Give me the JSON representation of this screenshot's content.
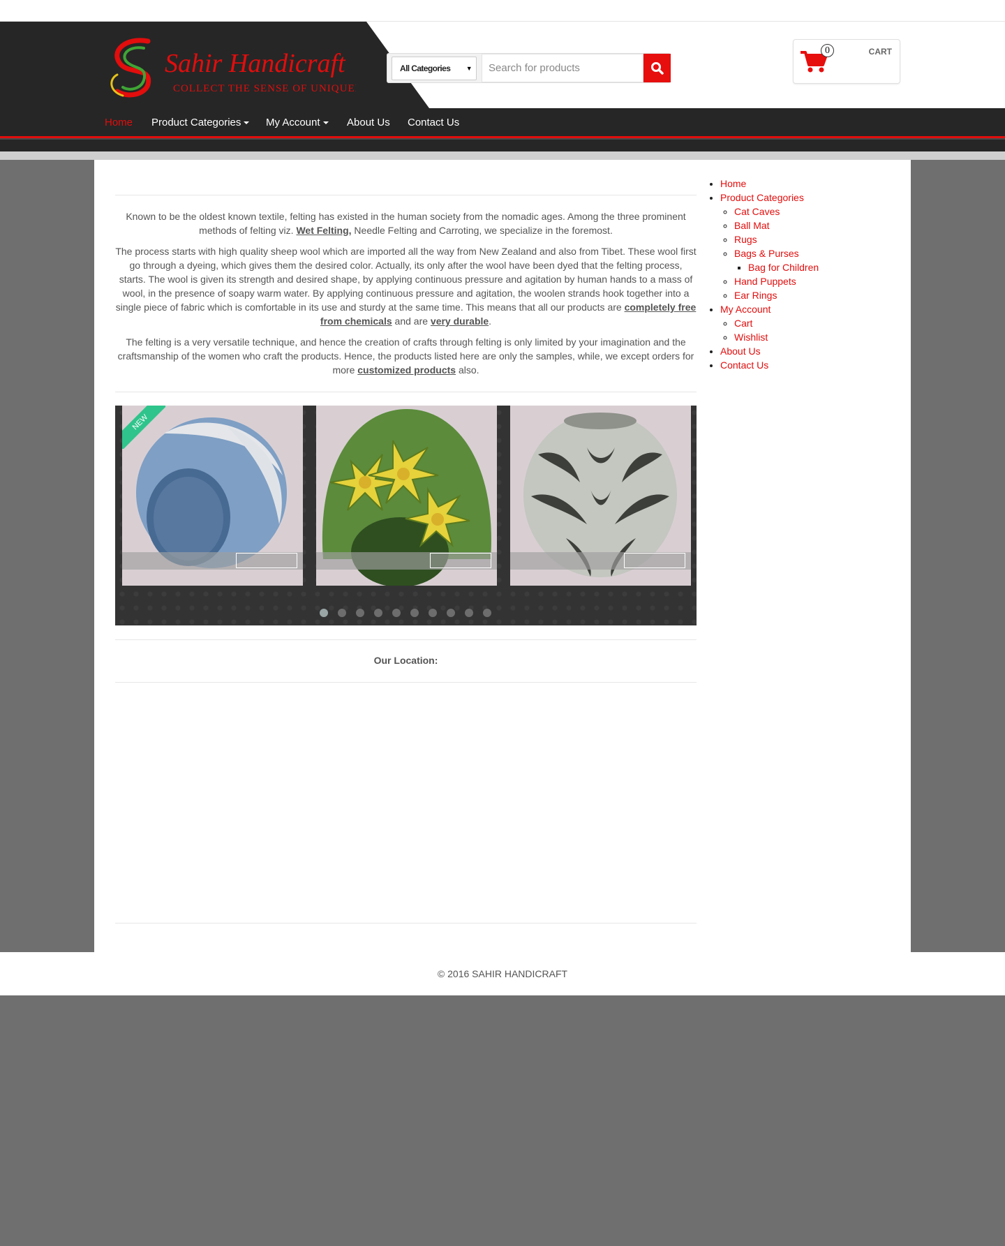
{
  "brand": {
    "name": "Sahir Handicraft",
    "tagline": "COLLECT THE SENSE OF UNIQUENESS"
  },
  "search": {
    "category": "All Categories",
    "placeholder": "Search for products",
    "button_icon": "search-icon"
  },
  "cart": {
    "count": "0",
    "label": "CART",
    "icon": "shopping-cart-icon"
  },
  "nav": {
    "items": [
      {
        "label": "Home",
        "active": true
      },
      {
        "label": "Product Categories",
        "dropdown": true
      },
      {
        "label": "My Account",
        "dropdown": true
      },
      {
        "label": "About Us"
      },
      {
        "label": "Contact Us"
      }
    ]
  },
  "intro": {
    "p1_a": "Known to be the oldest known textile, felting has existed in the human society from the nomadic ages. Among the three prominent methods of felting viz.",
    "p1_b": "Wet Felting,",
    "p1_c": "Needle Felting and Carroting, we specialize in the foremost.",
    "p2_a": "The process starts with high quality sheep wool which are imported all the way from New Zealand and also from Tibet. These wool first go through a dyeing, which gives them the desired color. Actually, its only after the wool have been dyed that the felting process, starts. The wool is given its strength and desired shape, by applying continuous pressure and agitation by human hands to a mass of wool, in the presence of soapy warm water. By applying continuous pressure and agitation, the woolen strands hook together into a single piece of fabric which is comfortable in its use and sturdy at the same time. This means that all our products are",
    "p2_b": "completely free from chemicals",
    "p2_c": "and are",
    "p2_d": "very durable",
    "p2_e": ".",
    "p3_a": "The felting is a very versatile technique, and hence the creation of crafts through felting is only limited by your imagination and the craftsmanship of the women who craft the products. Hence, the products listed here are only the samples, while, we except orders for more",
    "p3_b": "customized products",
    "p3_c": "also."
  },
  "slider": {
    "badge": "NEW",
    "slides": [
      "blue-felt-cat-cave",
      "green-flower-cat-cave",
      "grey-pattern-felt-bowl"
    ],
    "dots": 10,
    "active_dot": 0
  },
  "location": {
    "heading": "Our Location:"
  },
  "sidebar": {
    "home": "Home",
    "product_categories": "Product Categories",
    "cat_caves": "Cat Caves",
    "ball_mat": "Ball Mat",
    "rugs": "Rugs",
    "bags_purses": "Bags & Purses",
    "bag_children": "Bag for Children",
    "hand_puppets": "Hand Puppets",
    "ear_rings": "Ear Rings",
    "my_account": "My Account",
    "cart": "Cart",
    "wishlist": "Wishlist",
    "about_us": "About Us",
    "contact_us": "Contact Us"
  },
  "footer": {
    "text": "© 2016 SAHIR HANDICRAFT"
  },
  "colors": {
    "accent": "#e20d0d",
    "dark": "#262626",
    "page_bg": "#6f6f6f",
    "new_badge": "#2fc48b"
  }
}
